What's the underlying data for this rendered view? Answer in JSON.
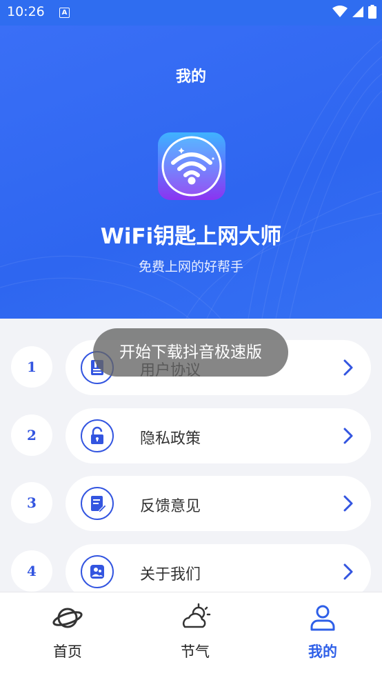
{
  "status": {
    "time": "10:26",
    "notification_glyph": "A"
  },
  "header": {
    "title": "我的",
    "app_name": "WiFi钥匙上网大师",
    "slogan": "免费上网的好帮手"
  },
  "menu": [
    {
      "number": "1",
      "label": "用户协议",
      "icon": "document-icon"
    },
    {
      "number": "2",
      "label": "隐私政策",
      "icon": "lock-icon"
    },
    {
      "number": "3",
      "label": "反馈意见",
      "icon": "edit-note-icon"
    },
    {
      "number": "4",
      "label": "关于我们",
      "icon": "people-icon"
    }
  ],
  "toast": {
    "text": "开始下载抖音极速版"
  },
  "tabs": [
    {
      "label": "首页",
      "icon": "planet-icon",
      "active": false
    },
    {
      "label": "节气",
      "icon": "weather-icon",
      "active": false
    },
    {
      "label": "我的",
      "icon": "person-icon",
      "active": true
    }
  ],
  "colors": {
    "primary": "#2f6df0",
    "accent": "#2e5fe8",
    "badge_text": "#3355e0"
  }
}
